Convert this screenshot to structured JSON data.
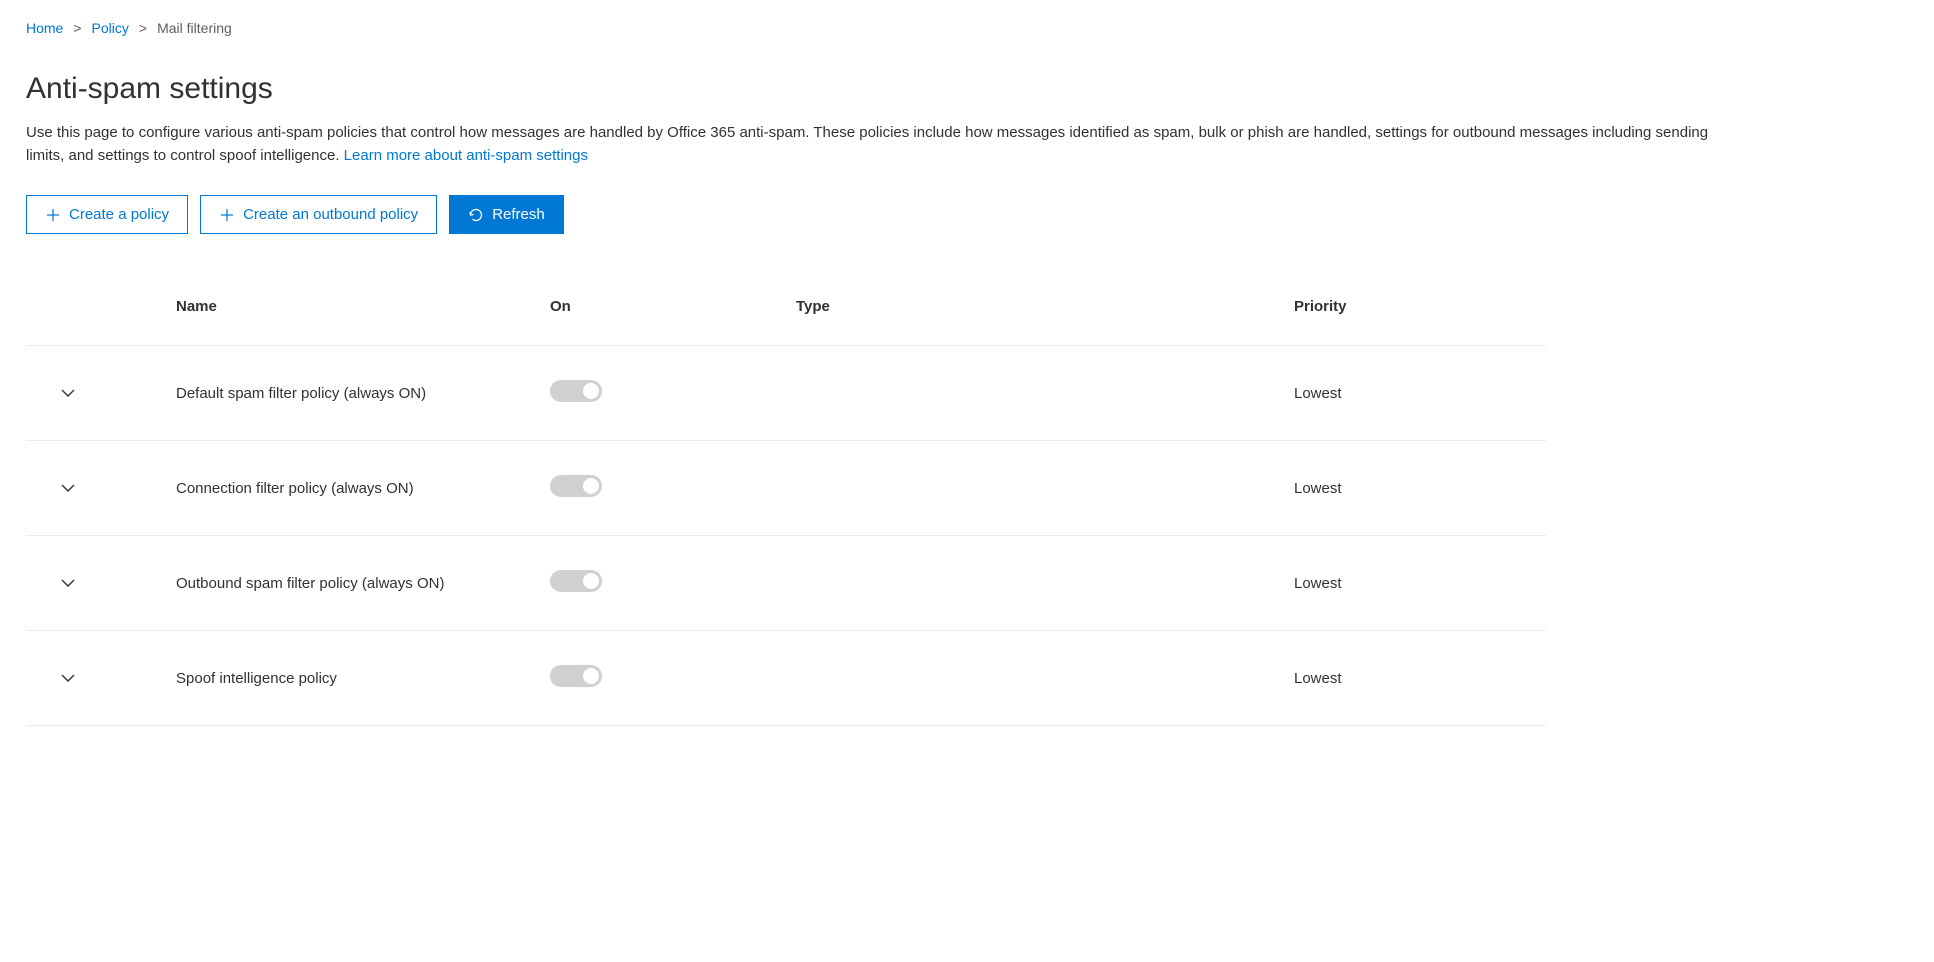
{
  "breadcrumb": {
    "items": [
      {
        "label": "Home"
      },
      {
        "label": "Policy"
      },
      {
        "label": "Mail filtering"
      }
    ]
  },
  "header": {
    "title": "Anti-spam settings",
    "description": "Use this page to configure various anti-spam policies that control how messages are handled by Office 365 anti-spam. These policies include how messages identified as spam, bulk or phish are handled, settings for outbound messages including sending limits, and settings to control spoof intelligence. ",
    "learn_more": "Learn more about anti-spam settings"
  },
  "toolbar": {
    "create_policy": "Create a policy",
    "create_outbound": "Create an outbound policy",
    "refresh": "Refresh"
  },
  "table": {
    "headers": {
      "name": "Name",
      "on": "On",
      "type": "Type",
      "priority": "Priority"
    },
    "rows": [
      {
        "name": "Default spam filter policy (always ON)",
        "type": "",
        "priority": "Lowest"
      },
      {
        "name": "Connection filter policy (always ON)",
        "type": "",
        "priority": "Lowest"
      },
      {
        "name": "Outbound spam filter policy (always ON)",
        "type": "",
        "priority": "Lowest"
      },
      {
        "name": "Spoof intelligence policy",
        "type": "",
        "priority": "Lowest"
      }
    ]
  }
}
